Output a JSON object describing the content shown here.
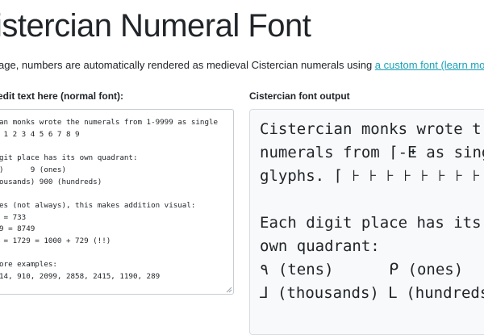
{
  "page": {
    "title": "istercian Numeral Font",
    "intro_before": "age, numbers are automatically rendered as medieval Cistercian numerals using ",
    "intro_link": "a custom font (learn more)",
    "intro_after": "."
  },
  "editor": {
    "label": "edit text here (normal font):",
    "lines": [
      "an monks wrote the numerals from 1-9999 as single",
      " 1 2 3 4 5 6 7 8 9",
      "",
      "git place has its own quadrant:",
      ")      9 (ones)",
      "ousands) 900 (hundreds)",
      "",
      "es (not always), this makes addition visual:",
      " = 733",
      "9 = 8749",
      " = 1729 = 1000 + 729 (!!)",
      "",
      "ore examples:",
      "14, 910, 2099, 2858, 2415, 1190, 289"
    ]
  },
  "output": {
    "label": "Cistercian font output",
    "lines": [
      "Cistercian monks wrote t",
      "numerals from ⌈-ⵟ as sing",
      "glyphs. ⌈ ⊦ ⊦ ⊦ ⊦ ⊦ ⊦ ⊦ ⊦",
      "",
      "Each digit place has its",
      "own quadrant:",
      "٩ (tens)      ᑭ (ones)",
      "⅃ (thousands) ᒪ (hundreds"
    ]
  },
  "colors": {
    "link": "#17a2b8",
    "output_background": "#f8f9fa",
    "border": "#c7cdd2"
  }
}
